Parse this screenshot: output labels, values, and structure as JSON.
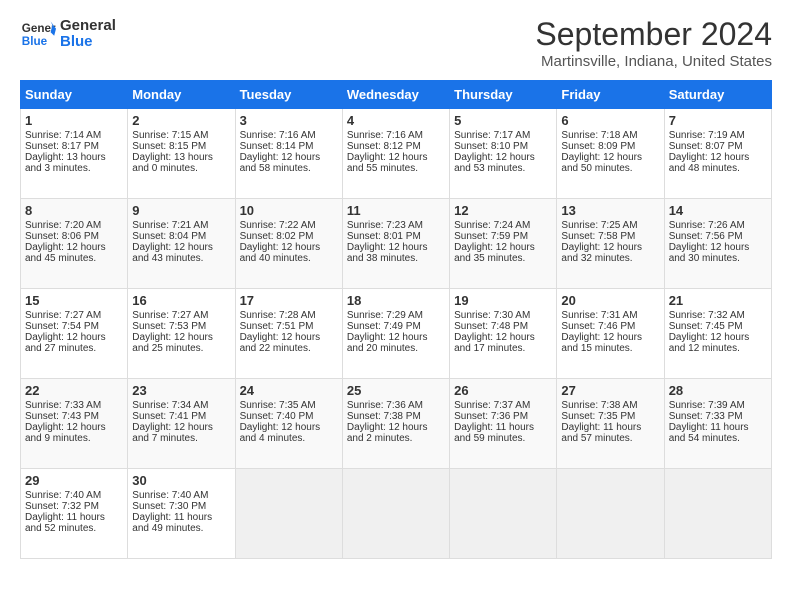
{
  "header": {
    "logo_line1": "General",
    "logo_line2": "Blue",
    "month": "September 2024",
    "location": "Martinsville, Indiana, United States"
  },
  "weekdays": [
    "Sunday",
    "Monday",
    "Tuesday",
    "Wednesday",
    "Thursday",
    "Friday",
    "Saturday"
  ],
  "weeks": [
    [
      {
        "day": "1",
        "sunrise": "Sunrise: 7:14 AM",
        "sunset": "Sunset: 8:17 PM",
        "daylight": "Daylight: 13 hours and 3 minutes."
      },
      {
        "day": "2",
        "sunrise": "Sunrise: 7:15 AM",
        "sunset": "Sunset: 8:15 PM",
        "daylight": "Daylight: 13 hours and 0 minutes."
      },
      {
        "day": "3",
        "sunrise": "Sunrise: 7:16 AM",
        "sunset": "Sunset: 8:14 PM",
        "daylight": "Daylight: 12 hours and 58 minutes."
      },
      {
        "day": "4",
        "sunrise": "Sunrise: 7:16 AM",
        "sunset": "Sunset: 8:12 PM",
        "daylight": "Daylight: 12 hours and 55 minutes."
      },
      {
        "day": "5",
        "sunrise": "Sunrise: 7:17 AM",
        "sunset": "Sunset: 8:10 PM",
        "daylight": "Daylight: 12 hours and 53 minutes."
      },
      {
        "day": "6",
        "sunrise": "Sunrise: 7:18 AM",
        "sunset": "Sunset: 8:09 PM",
        "daylight": "Daylight: 12 hours and 50 minutes."
      },
      {
        "day": "7",
        "sunrise": "Sunrise: 7:19 AM",
        "sunset": "Sunset: 8:07 PM",
        "daylight": "Daylight: 12 hours and 48 minutes."
      }
    ],
    [
      {
        "day": "8",
        "sunrise": "Sunrise: 7:20 AM",
        "sunset": "Sunset: 8:06 PM",
        "daylight": "Daylight: 12 hours and 45 minutes."
      },
      {
        "day": "9",
        "sunrise": "Sunrise: 7:21 AM",
        "sunset": "Sunset: 8:04 PM",
        "daylight": "Daylight: 12 hours and 43 minutes."
      },
      {
        "day": "10",
        "sunrise": "Sunrise: 7:22 AM",
        "sunset": "Sunset: 8:02 PM",
        "daylight": "Daylight: 12 hours and 40 minutes."
      },
      {
        "day": "11",
        "sunrise": "Sunrise: 7:23 AM",
        "sunset": "Sunset: 8:01 PM",
        "daylight": "Daylight: 12 hours and 38 minutes."
      },
      {
        "day": "12",
        "sunrise": "Sunrise: 7:24 AM",
        "sunset": "Sunset: 7:59 PM",
        "daylight": "Daylight: 12 hours and 35 minutes."
      },
      {
        "day": "13",
        "sunrise": "Sunrise: 7:25 AM",
        "sunset": "Sunset: 7:58 PM",
        "daylight": "Daylight: 12 hours and 32 minutes."
      },
      {
        "day": "14",
        "sunrise": "Sunrise: 7:26 AM",
        "sunset": "Sunset: 7:56 PM",
        "daylight": "Daylight: 12 hours and 30 minutes."
      }
    ],
    [
      {
        "day": "15",
        "sunrise": "Sunrise: 7:27 AM",
        "sunset": "Sunset: 7:54 PM",
        "daylight": "Daylight: 12 hours and 27 minutes."
      },
      {
        "day": "16",
        "sunrise": "Sunrise: 7:27 AM",
        "sunset": "Sunset: 7:53 PM",
        "daylight": "Daylight: 12 hours and 25 minutes."
      },
      {
        "day": "17",
        "sunrise": "Sunrise: 7:28 AM",
        "sunset": "Sunset: 7:51 PM",
        "daylight": "Daylight: 12 hours and 22 minutes."
      },
      {
        "day": "18",
        "sunrise": "Sunrise: 7:29 AM",
        "sunset": "Sunset: 7:49 PM",
        "daylight": "Daylight: 12 hours and 20 minutes."
      },
      {
        "day": "19",
        "sunrise": "Sunrise: 7:30 AM",
        "sunset": "Sunset: 7:48 PM",
        "daylight": "Daylight: 12 hours and 17 minutes."
      },
      {
        "day": "20",
        "sunrise": "Sunrise: 7:31 AM",
        "sunset": "Sunset: 7:46 PM",
        "daylight": "Daylight: 12 hours and 15 minutes."
      },
      {
        "day": "21",
        "sunrise": "Sunrise: 7:32 AM",
        "sunset": "Sunset: 7:45 PM",
        "daylight": "Daylight: 12 hours and 12 minutes."
      }
    ],
    [
      {
        "day": "22",
        "sunrise": "Sunrise: 7:33 AM",
        "sunset": "Sunset: 7:43 PM",
        "daylight": "Daylight: 12 hours and 9 minutes."
      },
      {
        "day": "23",
        "sunrise": "Sunrise: 7:34 AM",
        "sunset": "Sunset: 7:41 PM",
        "daylight": "Daylight: 12 hours and 7 minutes."
      },
      {
        "day": "24",
        "sunrise": "Sunrise: 7:35 AM",
        "sunset": "Sunset: 7:40 PM",
        "daylight": "Daylight: 12 hours and 4 minutes."
      },
      {
        "day": "25",
        "sunrise": "Sunrise: 7:36 AM",
        "sunset": "Sunset: 7:38 PM",
        "daylight": "Daylight: 12 hours and 2 minutes."
      },
      {
        "day": "26",
        "sunrise": "Sunrise: 7:37 AM",
        "sunset": "Sunset: 7:36 PM",
        "daylight": "Daylight: 11 hours and 59 minutes."
      },
      {
        "day": "27",
        "sunrise": "Sunrise: 7:38 AM",
        "sunset": "Sunset: 7:35 PM",
        "daylight": "Daylight: 11 hours and 57 minutes."
      },
      {
        "day": "28",
        "sunrise": "Sunrise: 7:39 AM",
        "sunset": "Sunset: 7:33 PM",
        "daylight": "Daylight: 11 hours and 54 minutes."
      }
    ],
    [
      {
        "day": "29",
        "sunrise": "Sunrise: 7:40 AM",
        "sunset": "Sunset: 7:32 PM",
        "daylight": "Daylight: 11 hours and 52 minutes."
      },
      {
        "day": "30",
        "sunrise": "Sunrise: 7:40 AM",
        "sunset": "Sunset: 7:30 PM",
        "daylight": "Daylight: 11 hours and 49 minutes."
      },
      null,
      null,
      null,
      null,
      null
    ]
  ]
}
